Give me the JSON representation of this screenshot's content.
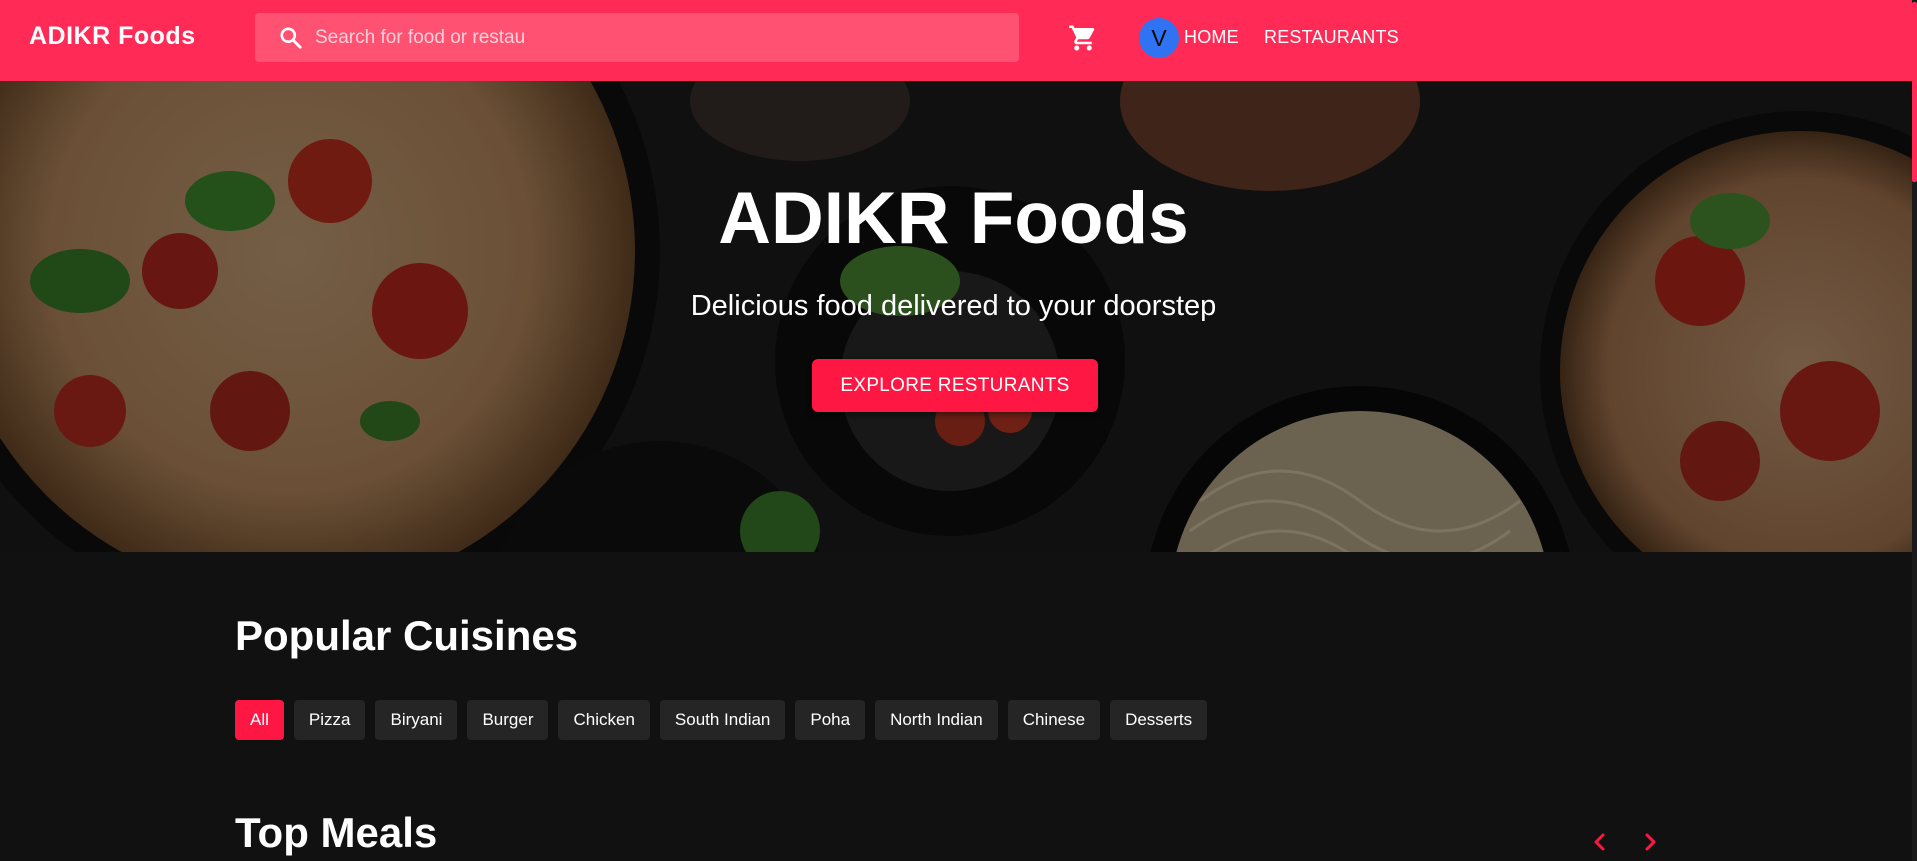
{
  "navbar": {
    "brand": "ADIKR Foods",
    "search_placeholder": "Search for food or restau",
    "avatar_initial": "V",
    "links": [
      "HOME",
      "RESTAURANTS"
    ]
  },
  "hero": {
    "title": "ADIKR Foods",
    "subtitle": "Delicious food delivered to your doorstep",
    "cta_label": "EXPLORE RESTURANTS"
  },
  "cuisines": {
    "title": "Popular Cuisines",
    "chips": [
      "All",
      "Pizza",
      "Biryani",
      "Burger",
      "Chicken",
      "South Indian",
      "Poha",
      "North Indian",
      "Chinese",
      "Desserts"
    ],
    "active": "All"
  },
  "meals": {
    "title": "Top Meals"
  },
  "colors": {
    "brand": "#ff2a55",
    "accent": "#ff1744",
    "background": "#111111",
    "chip": "#252525",
    "avatar": "#2f73f2"
  },
  "icons": [
    "search-icon",
    "cart-icon",
    "chevron-left-icon",
    "chevron-right-icon"
  ]
}
